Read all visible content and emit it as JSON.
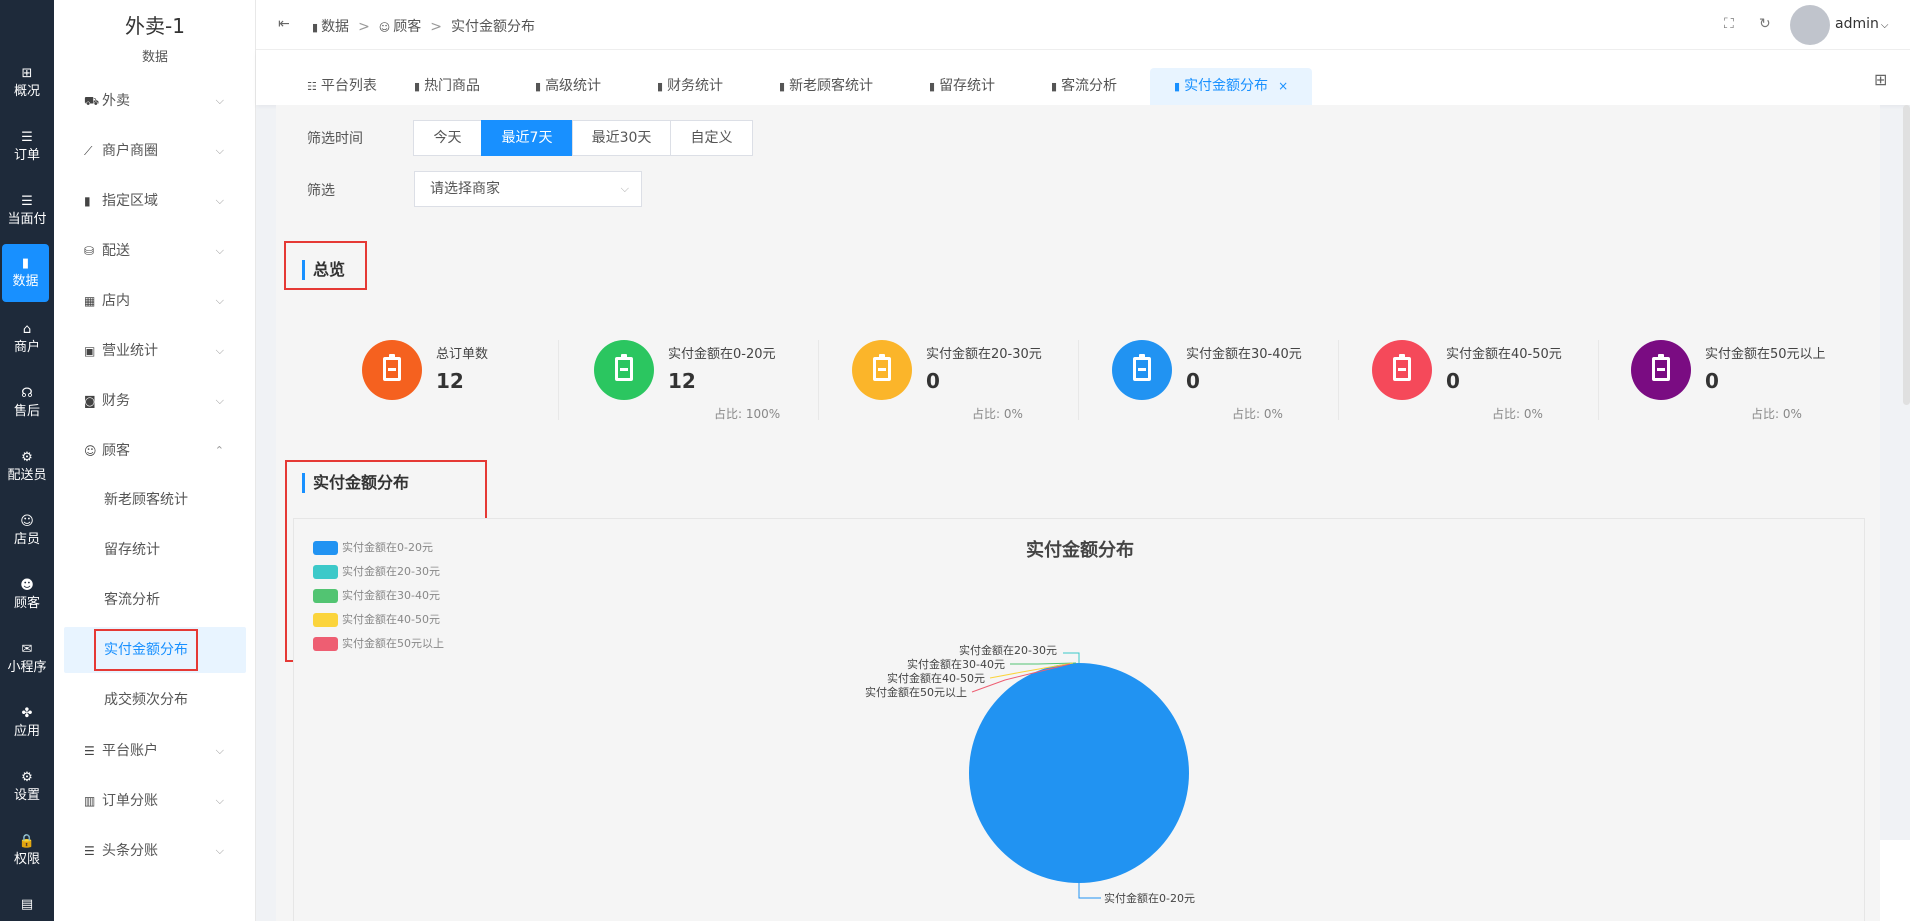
{
  "rail": {
    "items": [
      {
        "label": "概况",
        "icon": "grid-icon",
        "glyph": "⊞"
      },
      {
        "label": "订单",
        "icon": "list-icon",
        "glyph": "☰"
      },
      {
        "label": "当面付",
        "icon": "list-icon",
        "glyph": "☰"
      },
      {
        "label": "数据",
        "icon": "bar-chart-icon",
        "glyph": "▮"
      },
      {
        "label": "商户",
        "icon": "shop-icon",
        "glyph": "⌂"
      },
      {
        "label": "售后",
        "icon": "headset-icon",
        "glyph": "☊"
      },
      {
        "label": "配送员",
        "icon": "scooter-icon",
        "glyph": "⚙"
      },
      {
        "label": "店员",
        "icon": "users-icon",
        "glyph": "☺"
      },
      {
        "label": "顾客",
        "icon": "user-circle-icon",
        "glyph": "☻"
      },
      {
        "label": "小程序",
        "icon": "wechat-icon",
        "glyph": "✉"
      },
      {
        "label": "应用",
        "icon": "apps-icon",
        "glyph": "✤"
      },
      {
        "label": "设置",
        "icon": "settings-user-icon",
        "glyph": "⚙"
      },
      {
        "label": "权限",
        "icon": "lock-icon",
        "glyph": "🔒"
      },
      {
        "label": "",
        "icon": "report-icon",
        "glyph": "▤"
      }
    ],
    "active_index": 3
  },
  "sidebar": {
    "title": "外卖-1",
    "subtitle": "数据",
    "menu": [
      {
        "label": "外卖",
        "icon": "scooter-icon",
        "glyph": "⛟",
        "chevron": "⌵"
      },
      {
        "label": "商户商圈",
        "icon": "line-chart-icon",
        "glyph": "⟋",
        "chevron": "⌵"
      },
      {
        "label": "指定区域",
        "icon": "bar-chart-icon",
        "glyph": "▮",
        "chevron": "⌵"
      },
      {
        "label": "配送",
        "icon": "bag-icon",
        "glyph": "⛁",
        "chevron": "⌵"
      },
      {
        "label": "店内",
        "icon": "store-icon",
        "glyph": "▦",
        "chevron": "⌵"
      },
      {
        "label": "营业统计",
        "icon": "calendar-icon",
        "glyph": "▣",
        "chevron": "⌵"
      },
      {
        "label": "财务",
        "icon": "finance-icon",
        "glyph": "◙",
        "chevron": "⌵"
      },
      {
        "label": "顾客",
        "icon": "customer-icon",
        "glyph": "☺",
        "chevron": "⌃"
      }
    ],
    "sub_items": [
      "新老顾客统计",
      "留存统计",
      "客流分析",
      "实付金额分布",
      "成交频次分布"
    ],
    "active_sub": "实付金额分布",
    "menu_after": [
      {
        "label": "平台账户",
        "icon": "account-icon",
        "glyph": "☰",
        "chevron": "⌵"
      },
      {
        "label": "订单分账",
        "icon": "split-icon",
        "glyph": "▥",
        "chevron": "⌵"
      },
      {
        "label": "头条分账",
        "icon": "split-icon",
        "glyph": "☰",
        "chevron": "⌵"
      }
    ]
  },
  "header": {
    "collapse_glyph": "⇤",
    "breadcrumb": [
      "数据",
      "顾客",
      "实付金额分布"
    ],
    "separator": ">",
    "fullscreen_glyph": "⛶",
    "refresh_glyph": "↻",
    "user": "admin",
    "user_chevron": "⌵"
  },
  "tabs": {
    "items": [
      {
        "label": "平台列表",
        "glyph": "☷"
      },
      {
        "label": "热门商品",
        "glyph": "▮"
      },
      {
        "label": "高级统计",
        "glyph": "▮"
      },
      {
        "label": "财务统计",
        "glyph": "▮"
      },
      {
        "label": "新老顾客统计",
        "glyph": "▮"
      },
      {
        "label": "留存统计",
        "glyph": "▮"
      },
      {
        "label": "客流分析",
        "glyph": "▮"
      },
      {
        "label": "实付金额分布",
        "glyph": "▮"
      }
    ],
    "active": "实付金额分布",
    "close_glyph": "×",
    "grid_glyph": "⊞"
  },
  "filters": {
    "time_label": "筛选时间",
    "time_options": [
      "今天",
      "最近7天",
      "最近30天",
      "自定义"
    ],
    "time_selected": "最近7天",
    "merchant_label": "筛选",
    "merchant_placeholder": "请选择商家",
    "select_arrow": "⌵"
  },
  "overview": {
    "title": "总览",
    "stats": [
      {
        "label": "总订单数",
        "value": "12",
        "pct": "",
        "color": "#f5611f"
      },
      {
        "label": "实付金额在0-20元",
        "value": "12",
        "pct": "占比: 100%",
        "color": "#2bc660"
      },
      {
        "label": "实付金额在20-30元",
        "value": "0",
        "pct": "占比: 0%",
        "color": "#fbb52a"
      },
      {
        "label": "实付金额在30-40元",
        "value": "0",
        "pct": "占比: 0%",
        "color": "#2193f2"
      },
      {
        "label": "实付金额在40-50元",
        "value": "0",
        "pct": "占比: 0%",
        "color": "#f5495a"
      },
      {
        "label": "实付金额在50元以上",
        "value": "0",
        "pct": "占比: 0%",
        "color": "#7a0c82"
      }
    ]
  },
  "distribution": {
    "section_title": "实付金额分布"
  },
  "chart_data": {
    "type": "pie",
    "title": "实付金额分布",
    "legend_position": "top-left",
    "categories": [
      "实付金额在0-20元",
      "实付金额在20-30元",
      "实付金额在30-40元",
      "实付金额在40-50元",
      "实付金额在50元以上"
    ],
    "values": [
      12,
      0,
      0,
      0,
      0
    ],
    "colors": [
      "#2193f2",
      "#3cc9c9",
      "#52c472",
      "#fbd43c",
      "#ee5e72"
    ]
  }
}
